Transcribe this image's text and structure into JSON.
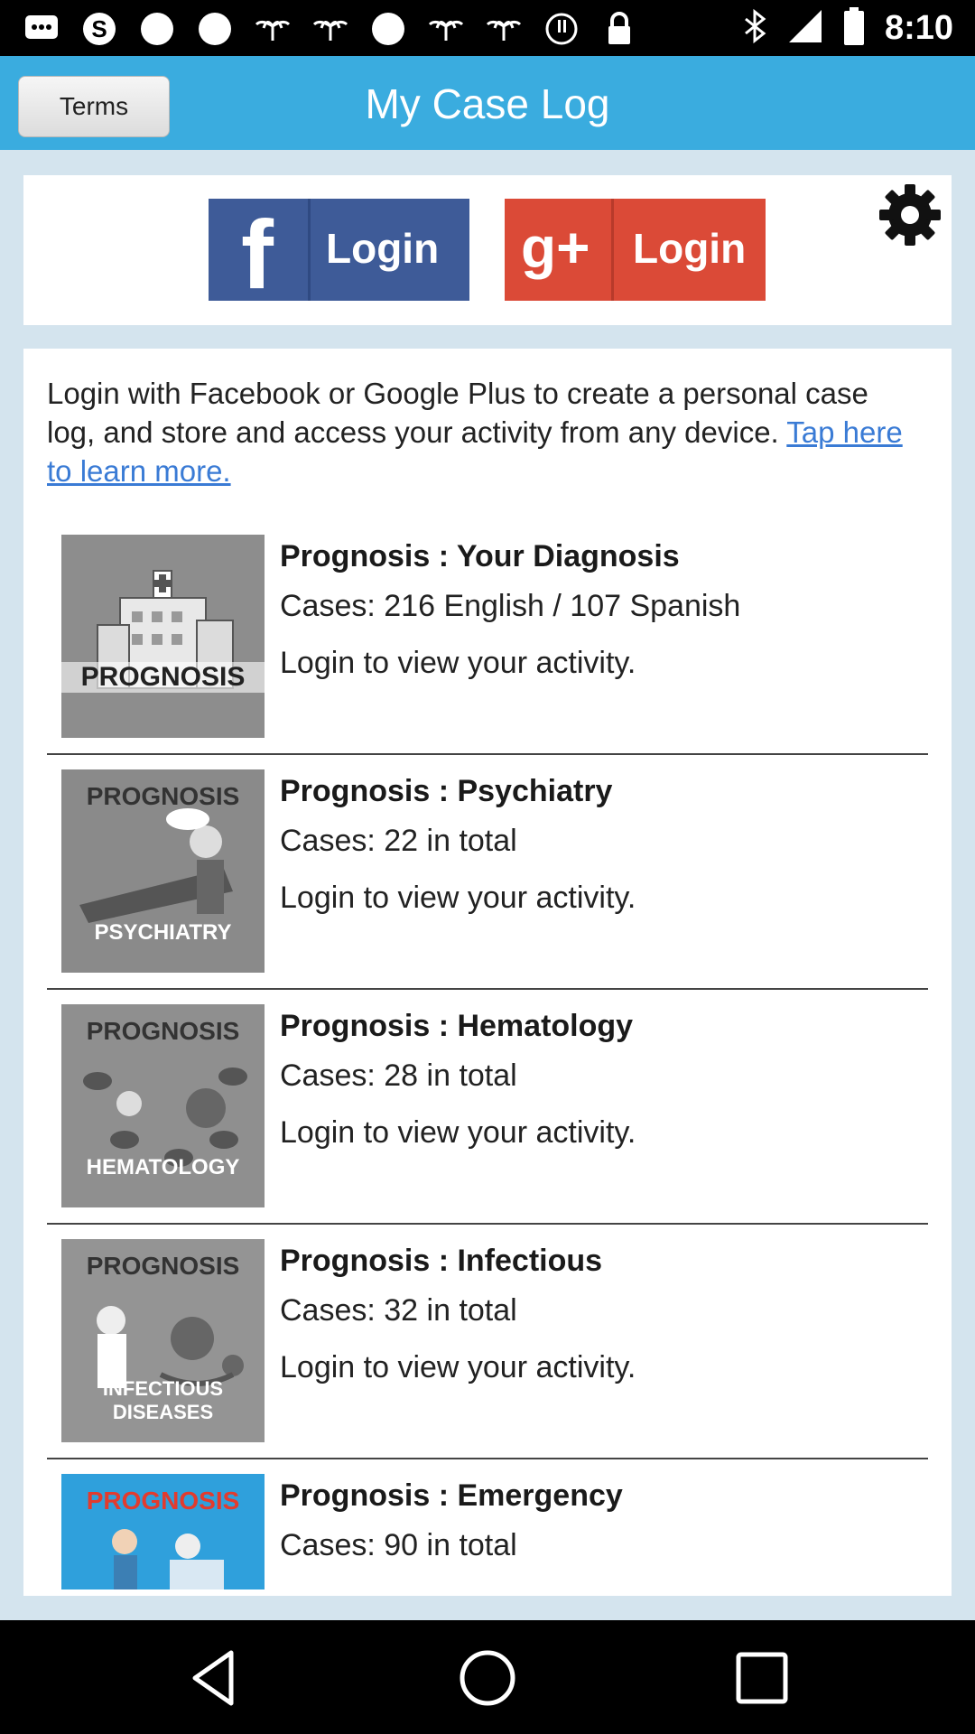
{
  "status_bar": {
    "time": "8:10"
  },
  "app_bar": {
    "terms_label": "Terms",
    "title": "My Case Log"
  },
  "login": {
    "facebook_label": "Login",
    "facebook_glyph": "f",
    "google_label": "Login",
    "google_glyph": "g+"
  },
  "intro": {
    "text": "Login with Facebook or Google Plus to create a personal case log, and store and access your activity from any device. ",
    "link": "Tap here to learn more."
  },
  "cases": [
    {
      "title": "Prognosis : Your Diagnosis",
      "cases": "Cases: 216 English / 107 Spanish",
      "activity": "Login to view your activity.",
      "thumb_top": "",
      "thumb_bottom": "PROGNOSIS"
    },
    {
      "title": "Prognosis : Psychiatry",
      "cases": "Cases: 22 in total",
      "activity": "Login to view your activity.",
      "thumb_top": "PROGNOSIS",
      "thumb_bottom": "PSYCHIATRY"
    },
    {
      "title": "Prognosis : Hematology",
      "cases": "Cases: 28 in total",
      "activity": "Login to view your activity.",
      "thumb_top": "PROGNOSIS",
      "thumb_bottom": "HEMATOLOGY"
    },
    {
      "title": "Prognosis : Infectious",
      "cases": "Cases: 32 in total",
      "activity": "Login to view your activity.",
      "thumb_top": "PROGNOSIS",
      "thumb_bottom": "INFECTIOUS DISEASES"
    },
    {
      "title": "Prognosis : Emergency",
      "cases": "Cases: 90 in total",
      "activity": "",
      "thumb_top": "PROGNOSIS",
      "thumb_bottom": ""
    }
  ],
  "colors": {
    "app_bar": "#3aacdf",
    "facebook": "#3e5b98",
    "google": "#db4a37",
    "link": "#3a7bd5",
    "background": "#d4e4ee"
  }
}
